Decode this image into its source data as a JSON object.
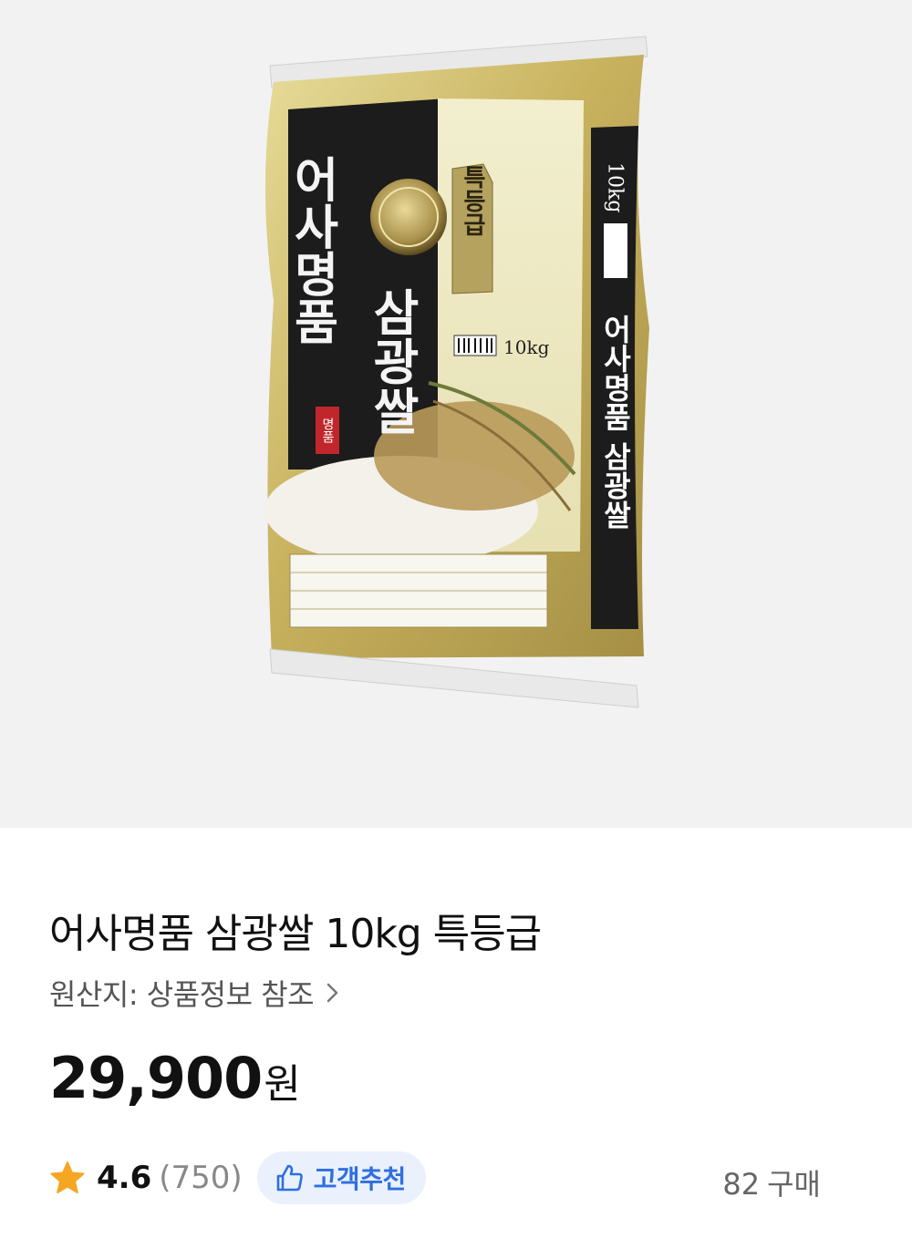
{
  "package": {
    "vertical_title": "어사명품",
    "side_title": "삼광쌀",
    "grade_tag": "특등급",
    "seal": "명품",
    "front_weight": "10kg",
    "side_weight": "10kg",
    "side_text": "어사명품 삼광쌀"
  },
  "product": {
    "title": "어사명품 삼광쌀 10kg 특등급",
    "origin": "원산지: 상품정보 참조",
    "price": "29,900",
    "price_unit": "원"
  },
  "rating": {
    "value": "4.6",
    "count": "(750)",
    "badge_label": "고객추천",
    "purchase_count": "82",
    "purchase_label": "구매"
  },
  "colors": {
    "background": "#f2f2f2",
    "badge_bg": "#eaf1fd",
    "badge_text": "#2f6fe0",
    "star": "#f5a623",
    "bag_gold": "#c9b46a",
    "bag_black": "#1c1c1c"
  }
}
